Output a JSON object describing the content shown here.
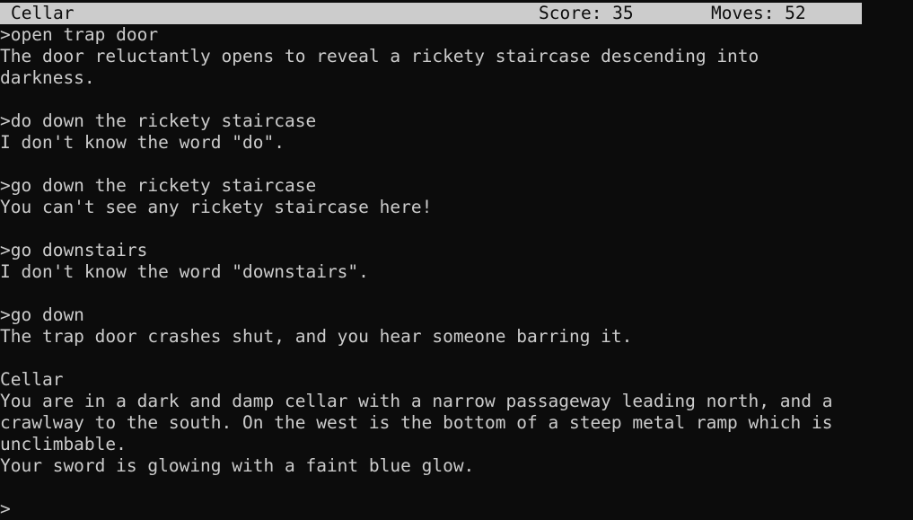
{
  "status_bar": {
    "location": "Cellar",
    "score_label": "Score: 35",
    "moves_label": "Moves: 52"
  },
  "transcript": [
    ">open trap door",
    "The door reluctantly opens to reveal a rickety staircase descending into",
    "darkness.",
    "",
    ">do down the rickety staircase",
    "I don't know the word \"do\".",
    "",
    ">go down the rickety staircase",
    "You can't see any rickety staircase here!",
    "",
    ">go downstairs",
    "I don't know the word \"downstairs\".",
    "",
    ">go down",
    "The trap door crashes shut, and you hear someone barring it.",
    "",
    "Cellar",
    "You are in a dark and damp cellar with a narrow passageway leading north, and a",
    "crawlway to the south. On the west is the bottom of a steep metal ramp which is",
    "unclimbable.",
    "Your sword is glowing with a faint blue glow.",
    "",
    ">"
  ],
  "colors": {
    "background": "#0c0c0c",
    "foreground": "#cccccc",
    "status_bar_background": "#cccccc",
    "status_bar_foreground": "#0c0c0c"
  }
}
